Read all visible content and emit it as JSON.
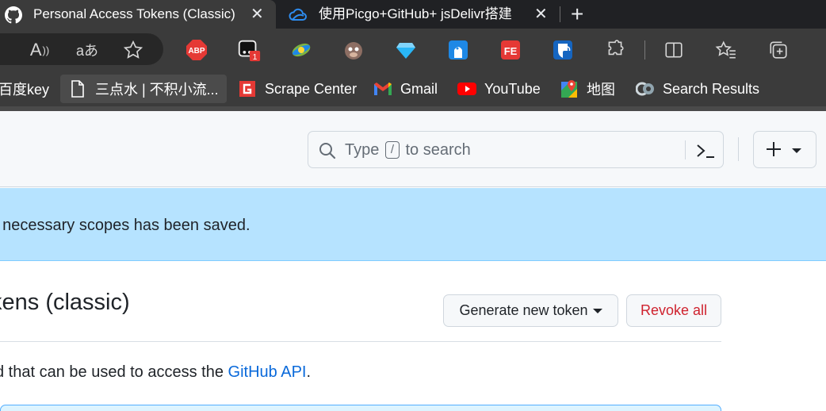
{
  "browser": {
    "tabs": [
      {
        "title": "Personal Access Tokens (Classic)",
        "icon": "github-icon",
        "active": true
      },
      {
        "title": "使用Picgo+GitHub+ jsDelivr搭建",
        "icon": "cloud-icon",
        "active": false
      }
    ],
    "close_glyph": "✕",
    "new_tab_glyph": "+",
    "toolbar": {
      "read_aloud_glyph": "A",
      "translate_glyph": "aあ",
      "extension_badge": "1",
      "abp_label": "ABP",
      "fe_label": "FE"
    },
    "bookmarks": [
      {
        "label": "百度key",
        "icon": "none"
      },
      {
        "label": "三点水 | 不积小流...",
        "icon": "page-icon"
      },
      {
        "label": "Scrape Center",
        "icon": "scrape-center-icon"
      },
      {
        "label": "Gmail",
        "icon": "gmail-icon"
      },
      {
        "label": "YouTube",
        "icon": "youtube-icon"
      },
      {
        "label": "地图",
        "icon": "maps-icon"
      },
      {
        "label": "Search Results",
        "icon": "search-results-icon"
      }
    ]
  },
  "github": {
    "search": {
      "placeholder_before": "Type",
      "shortcut_key": "/",
      "placeholder_after": "to search"
    },
    "flash_message": "f necessary scopes has been saved.",
    "page_title": "kens (classic)",
    "buttons": {
      "generate": "Generate new token",
      "revoke": "Revoke all"
    },
    "description": {
      "before": "d that can be used to access the ",
      "link": "GitHub API",
      "after": "."
    }
  },
  "colors": {
    "browser_dark": "#202124",
    "toolbar": "#3b3b3b",
    "flash_bg": "#b6e3ff",
    "link": "#0969da",
    "danger": "#cf222e"
  }
}
